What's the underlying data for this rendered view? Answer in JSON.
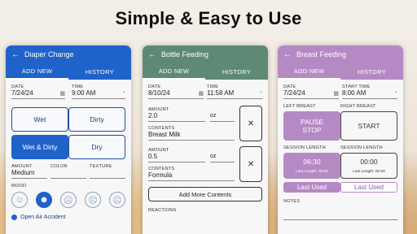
{
  "headline": "Simple & Easy to Use",
  "back_glyph": "←",
  "diaper": {
    "title": "Diaper Change",
    "tabs": [
      "ADD NEW",
      "HISTORY"
    ],
    "date_label": "DATE",
    "date_value": "7/24/24",
    "time_label": "TIME",
    "time_value": "9:00 AM",
    "types": [
      "Wet",
      "Dirty",
      "Wet & Dirty",
      "Dry"
    ],
    "amount_label": "AMOUNT",
    "amount_value": "Medium",
    "color_label": "COLOR",
    "texture_label": "TEXTURE",
    "mood_label": "MOOD",
    "moods": [
      "☺",
      "☻",
      "☹",
      "☹",
      "☹"
    ],
    "open_air_label": "Open Air Accident",
    "accent": "#1f62c9"
  },
  "bottle": {
    "title": "Bottle Feeding",
    "tabs": [
      "ADD NEW",
      "HISTORY"
    ],
    "date_label": "DATE",
    "date_value": "8/10/24",
    "time_label": "TIME",
    "time_value": "11:58 AM",
    "entries": [
      {
        "amount_label": "AMOUNT",
        "amount_value": "2.0",
        "unit": "oz",
        "contents_label": "CONTENTS",
        "contents_value": "Breast Milk"
      },
      {
        "amount_label": "AMOUNT",
        "amount_value": "0.5",
        "unit": "oz",
        "contents_label": "CONTENTS",
        "contents_value": "Formula"
      }
    ],
    "add_more_label": "Add More Contents",
    "reactions_label": "REACTIONS",
    "accent": "#5e8a75"
  },
  "breast": {
    "title": "Breast Feeding",
    "tabs": [
      "ADD NEW",
      "HISTORY"
    ],
    "date_label": "DATE",
    "date_value": "7/24/24",
    "time_label": "START TIME",
    "time_value": "8:00 AM",
    "left_label": "LEFT BREAST",
    "right_label": "RIGHT BREAST",
    "left_button": "PAUSE\nSTOP",
    "right_button": "START",
    "left_session_label": "SESSION LENGTH",
    "right_session_label": "SESSION LENGTH",
    "left_session_value": "06:30",
    "right_session_value": "00:00",
    "left_last_length": "Last Length: 00:00",
    "right_last_length": "Last Length: 00:00",
    "last_used_label": "Last Used",
    "notes_label": "NOTES",
    "accent": "#b58ac4"
  }
}
